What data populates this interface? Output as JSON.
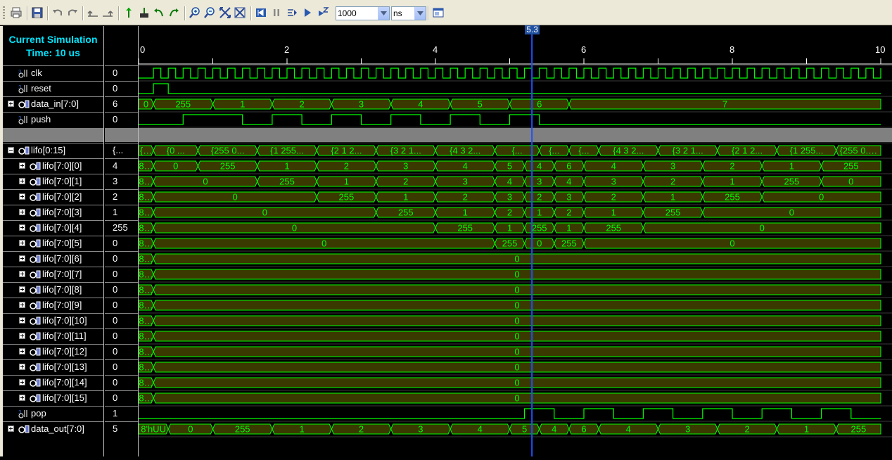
{
  "toolbar": {
    "buttons": [
      "print-icon",
      "save-icon",
      "undo-icon",
      "redo-icon",
      "undo-history-icon",
      "redo-history-icon",
      "add-marker-icon",
      "find-marker-icon",
      "previous-marker-icon",
      "next-marker-icon",
      "zoom-in-icon",
      "zoom-out-icon",
      "zoom-fit-icon",
      "zoom-full-icon",
      "restart-icon",
      "pause-icon",
      "step-icon",
      "run-icon",
      "run-for-icon",
      "float-window-icon"
    ],
    "run_time": "1000",
    "units": "ns"
  },
  "sim_time": {
    "line1": "Current Simulation",
    "line2": "Time: 10 us"
  },
  "cursor": {
    "label": "5.3",
    "time": 5.3
  },
  "ruler": {
    "ticks": [
      "0",
      "2",
      "4",
      "6",
      "8",
      "10"
    ],
    "unit": "us",
    "range": [
      0,
      10
    ]
  },
  "colors": {
    "signal": "#00ff00",
    "bus_fill": "#3a3a00",
    "cursor": "#2050ff",
    "label_cyan": "#00e5ff"
  },
  "signals": [
    {
      "name": "clk",
      "value": "0",
      "kind": "bit",
      "expand": ""
    },
    {
      "name": "reset",
      "value": "0",
      "kind": "bit",
      "expand": ""
    },
    {
      "name": "data_in[7:0]",
      "value": "6",
      "kind": "bus",
      "expand": "plus"
    },
    {
      "name": "push",
      "value": "0",
      "kind": "bit",
      "expand": ""
    },
    {
      "name": "",
      "value": "",
      "kind": "gap",
      "expand": ""
    },
    {
      "name": "lifo[0:15]",
      "value": "{...",
      "kind": "bus",
      "expand": "minus"
    },
    {
      "name": "lifo[7:0][0]",
      "value": "4",
      "kind": "bus",
      "expand": "plus"
    },
    {
      "name": "lifo[7:0][1]",
      "value": "3",
      "kind": "bus",
      "expand": "plus"
    },
    {
      "name": "lifo[7:0][2]",
      "value": "2",
      "kind": "bus",
      "expand": "plus"
    },
    {
      "name": "lifo[7:0][3]",
      "value": "1",
      "kind": "bus",
      "expand": "plus"
    },
    {
      "name": "lifo[7:0][4]",
      "value": "255",
      "kind": "bus",
      "expand": "plus"
    },
    {
      "name": "lifo[7:0][5]",
      "value": "0",
      "kind": "bus",
      "expand": "plus"
    },
    {
      "name": "lifo[7:0][6]",
      "value": "0",
      "kind": "bus",
      "expand": "plus"
    },
    {
      "name": "lifo[7:0][7]",
      "value": "0",
      "kind": "bus",
      "expand": "plus"
    },
    {
      "name": "lifo[7:0][8]",
      "value": "0",
      "kind": "bus",
      "expand": "plus"
    },
    {
      "name": "lifo[7:0][9]",
      "value": "0",
      "kind": "bus",
      "expand": "plus"
    },
    {
      "name": "lifo[7:0][10]",
      "value": "0",
      "kind": "bus",
      "expand": "plus"
    },
    {
      "name": "lifo[7:0][11]",
      "value": "0",
      "kind": "bus",
      "expand": "plus"
    },
    {
      "name": "lifo[7:0][12]",
      "value": "0",
      "kind": "bus",
      "expand": "plus"
    },
    {
      "name": "lifo[7:0][13]",
      "value": "0",
      "kind": "bus",
      "expand": "plus"
    },
    {
      "name": "lifo[7:0][14]",
      "value": "0",
      "kind": "bus",
      "expand": "plus"
    },
    {
      "name": "lifo[7:0][15]",
      "value": "0",
      "kind": "bus",
      "expand": "plus"
    },
    {
      "name": "pop",
      "value": "1",
      "kind": "bit",
      "expand": ""
    },
    {
      "name": "data_out[7:0]",
      "value": "5",
      "kind": "bus",
      "expand": "plus"
    }
  ],
  "waves": {
    "clk": {
      "period": 0.2,
      "start": 0.2
    },
    "reset": [
      [
        0,
        0
      ],
      [
        0.2,
        1
      ],
      [
        0.4,
        0
      ]
    ],
    "push": [
      [
        0,
        0
      ],
      [
        0.6,
        1
      ],
      [
        1.4,
        0
      ],
      [
        1.8,
        1
      ],
      [
        2.2,
        0
      ],
      [
        2.6,
        1
      ],
      [
        3.0,
        0
      ],
      [
        3.4,
        1
      ],
      [
        3.8,
        0
      ],
      [
        4.2,
        1
      ],
      [
        4.6,
        0
      ],
      [
        5.0,
        1
      ],
      [
        5.4,
        0
      ],
      [
        5.8,
        0
      ]
    ],
    "pop": [
      [
        0,
        0
      ],
      [
        5.2,
        1
      ],
      [
        5.6,
        0
      ],
      [
        6.0,
        1
      ],
      [
        6.4,
        0
      ],
      [
        6.8,
        1
      ],
      [
        7.2,
        0
      ],
      [
        7.6,
        1
      ],
      [
        8.0,
        0
      ],
      [
        8.4,
        1
      ],
      [
        8.8,
        0
      ],
      [
        9.2,
        1
      ],
      [
        9.6,
        0
      ],
      [
        10,
        0
      ]
    ],
    "data_in": [
      [
        "0",
        0,
        0.2
      ],
      [
        "255",
        0.2,
        1.0
      ],
      [
        "1",
        1.0,
        1.8
      ],
      [
        "2",
        1.8,
        2.6
      ],
      [
        "3",
        2.6,
        3.4
      ],
      [
        "4",
        3.4,
        4.2
      ],
      [
        "5",
        4.2,
        5.0
      ],
      [
        "6",
        5.0,
        5.8
      ],
      [
        "7",
        5.8,
        10
      ]
    ],
    "lifo_top": [
      [
        "{...",
        0,
        0.2
      ],
      [
        "{0 ...",
        0.2,
        0.8
      ],
      [
        "{255 0...",
        0.8,
        1.6
      ],
      [
        "{1 255...",
        1.6,
        2.4
      ],
      [
        "{2 1 2...",
        2.4,
        3.2
      ],
      [
        "{3 2 1...",
        3.2,
        4.0
      ],
      [
        "{4 3 2...",
        4.0,
        4.8
      ],
      [
        "{...",
        4.8,
        5.4
      ],
      [
        "{...",
        5.4,
        5.8
      ],
      [
        "{...",
        5.8,
        6.2
      ],
      [
        "{4 3 2...",
        6.2,
        7.0
      ],
      [
        "{3 2 1...",
        7.0,
        7.8
      ],
      [
        "{2 1 2...",
        7.8,
        8.6
      ],
      [
        "{1 255...",
        8.6,
        9.4
      ],
      [
        "{255 0...",
        9.4,
        10
      ]
    ],
    "lifo0": [
      [
        "8...",
        0,
        0.2
      ],
      [
        "0",
        0.2,
        0.8
      ],
      [
        "255",
        0.8,
        1.6
      ],
      [
        "1",
        1.6,
        2.4
      ],
      [
        "2",
        2.4,
        3.2
      ],
      [
        "3",
        3.2,
        4.0
      ],
      [
        "4",
        4.0,
        4.8
      ],
      [
        "5",
        4.8,
        5.2
      ],
      [
        "4",
        5.2,
        5.6
      ],
      [
        "6",
        5.6,
        6.0
      ],
      [
        "4",
        6.0,
        6.8
      ],
      [
        "3",
        6.8,
        7.6
      ],
      [
        "2",
        7.6,
        8.4
      ],
      [
        "1",
        8.4,
        9.2
      ],
      [
        "255",
        9.2,
        10
      ]
    ],
    "lifo1": [
      [
        "8...",
        0,
        0.2
      ],
      [
        "0",
        0.2,
        1.6
      ],
      [
        "255",
        1.6,
        2.4
      ],
      [
        "1",
        2.4,
        3.2
      ],
      [
        "2",
        3.2,
        4.0
      ],
      [
        "3",
        4.0,
        4.8
      ],
      [
        "4",
        4.8,
        5.2
      ],
      [
        "3",
        5.2,
        5.6
      ],
      [
        "4",
        5.6,
        6.0
      ],
      [
        "3",
        6.0,
        6.8
      ],
      [
        "2",
        6.8,
        7.6
      ],
      [
        "1",
        7.6,
        8.4
      ],
      [
        "255",
        8.4,
        9.2
      ],
      [
        "0",
        9.2,
        10
      ]
    ],
    "lifo2": [
      [
        "8...",
        0,
        0.2
      ],
      [
        "0",
        0.2,
        2.4
      ],
      [
        "255",
        2.4,
        3.2
      ],
      [
        "1",
        3.2,
        4.0
      ],
      [
        "2",
        4.0,
        4.8
      ],
      [
        "3",
        4.8,
        5.2
      ],
      [
        "2",
        5.2,
        5.6
      ],
      [
        "3",
        5.6,
        6.0
      ],
      [
        "2",
        6.0,
        6.8
      ],
      [
        "1",
        6.8,
        7.6
      ],
      [
        "255",
        7.6,
        8.4
      ],
      [
        "0",
        8.4,
        10
      ]
    ],
    "lifo3": [
      [
        "8...",
        0,
        0.2
      ],
      [
        "0",
        0.2,
        3.2
      ],
      [
        "255",
        3.2,
        4.0
      ],
      [
        "1",
        4.0,
        4.8
      ],
      [
        "2",
        4.8,
        5.2
      ],
      [
        "1",
        5.2,
        5.6
      ],
      [
        "2",
        5.6,
        6.0
      ],
      [
        "1",
        6.0,
        6.8
      ],
      [
        "255",
        6.8,
        7.6
      ],
      [
        "0",
        7.6,
        10
      ]
    ],
    "lifo4": [
      [
        "8...",
        0,
        0.2
      ],
      [
        "0",
        0.2,
        4.0
      ],
      [
        "255",
        4.0,
        4.8
      ],
      [
        "1",
        4.8,
        5.2
      ],
      [
        "255",
        5.2,
        5.6
      ],
      [
        "1",
        5.6,
        6.0
      ],
      [
        "255",
        6.0,
        6.8
      ],
      [
        "0",
        6.8,
        10
      ]
    ],
    "lifo5": [
      [
        "8...",
        0,
        0.2
      ],
      [
        "0",
        0.2,
        4.8
      ],
      [
        "255",
        4.8,
        5.2
      ],
      [
        "0",
        5.2,
        5.6
      ],
      [
        "255",
        5.6,
        6.0
      ],
      [
        "0",
        6.0,
        10
      ]
    ],
    "lifo_rest": [
      [
        "8...",
        0,
        0.2
      ],
      [
        "0",
        0.2,
        10
      ]
    ],
    "data_out": [
      [
        "8'hUU",
        0,
        0.4
      ],
      [
        "0",
        0.4,
        1.0
      ],
      [
        "255",
        1.0,
        1.8
      ],
      [
        "1",
        1.8,
        2.6
      ],
      [
        "2",
        2.6,
        3.4
      ],
      [
        "3",
        3.4,
        4.2
      ],
      [
        "4",
        4.2,
        5.0
      ],
      [
        "5",
        5.0,
        5.4
      ],
      [
        "4",
        5.4,
        5.8
      ],
      [
        "6",
        5.8,
        6.2
      ],
      [
        "4",
        6.2,
        7.0
      ],
      [
        "3",
        7.0,
        7.8
      ],
      [
        "2",
        7.8,
        8.6
      ],
      [
        "1",
        8.6,
        9.4
      ],
      [
        "255",
        9.4,
        10
      ]
    ]
  }
}
